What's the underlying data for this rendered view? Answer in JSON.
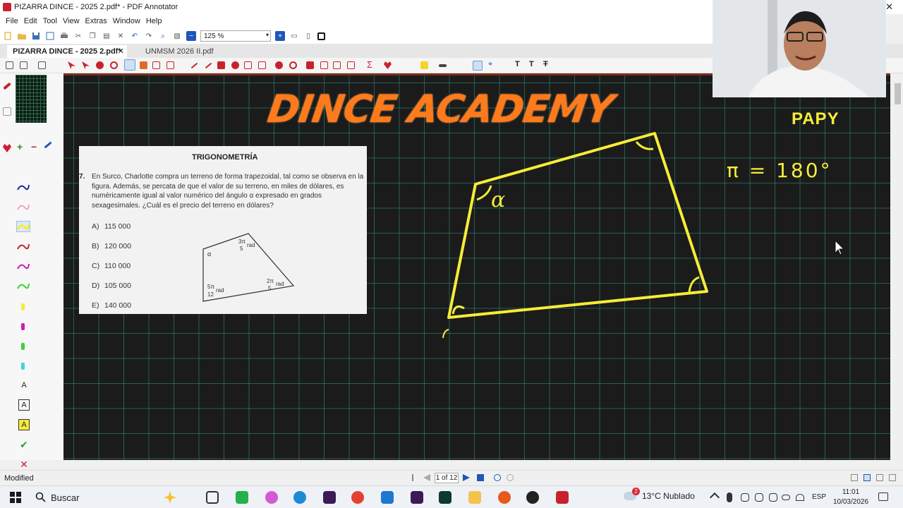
{
  "window": {
    "title": "PIZARRA DINCE - 2025 2.pdf* - PDF Annotator",
    "close_glyph": "✕"
  },
  "menu": [
    "File",
    "Edit",
    "Tool",
    "View",
    "Extras",
    "Window",
    "Help"
  ],
  "toolbar": {
    "zoom": "125 %"
  },
  "tabs": {
    "active": "PIZARRA DINCE - 2025 2.pdf*",
    "active_close": "✕",
    "inactive": "UNMSM 2026 II.pdf"
  },
  "canvas": {
    "logo": "DINCE ACADEMY",
    "papy": "PAPY",
    "pi_note": "π = 180°",
    "alpha_label": "α",
    "accent_color": "#f6ec38",
    "logo_color": "#ff7a1a"
  },
  "question": {
    "heading": "TRIGONOMETRÍA",
    "number": "7.",
    "text": "En Surco, Charlotte compra un terreno de forma trapezoidal, tal como se observa en la figura. Además, se percata de que el valor de su terreno, en miles de dólares, es numéricamente igual al valor numérico del ángulo α expresado en grados sexagesimales. ¿Cuál es el precio del terreno en dólares?",
    "options": [
      {
        "key": "A)",
        "value": "115 000"
      },
      {
        "key": "B)",
        "value": "120 000"
      },
      {
        "key": "C)",
        "value": "110 000"
      },
      {
        "key": "D)",
        "value": "105 000"
      },
      {
        "key": "E)",
        "value": "140 000"
      }
    ],
    "figure": {
      "alpha": "α",
      "top_right_num": "3π",
      "top_right_den": "5",
      "right_num": "2π",
      "right_den": "5",
      "left_num": "5π",
      "left_den": "12",
      "rad": "rad"
    }
  },
  "status": {
    "text": "Modified",
    "page": "1 of 12"
  },
  "taskbar": {
    "search": "Buscar",
    "weather": "13°C  Nublado",
    "weather_badge": "2",
    "lang": "ESP",
    "time": "11:01",
    "date": "10/03/2026"
  }
}
